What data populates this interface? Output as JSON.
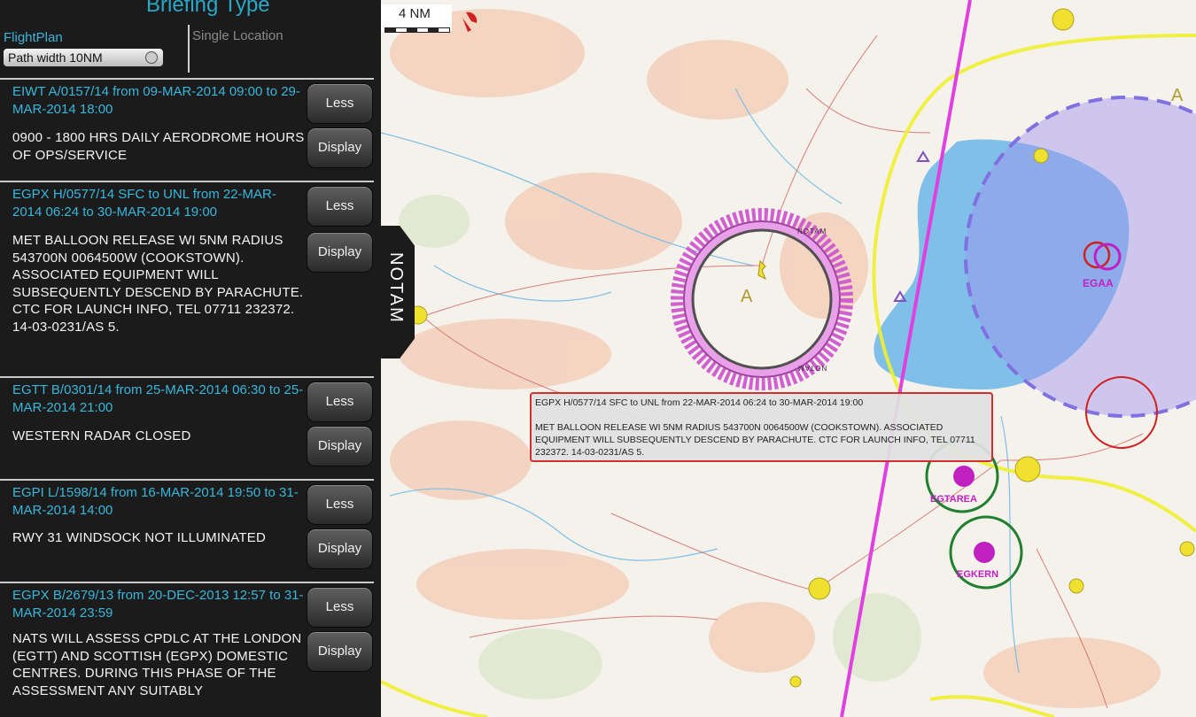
{
  "briefing": {
    "title": "Briefing Type",
    "tabs": {
      "flight_plan": "FlightPlan",
      "single_location": "Single Location"
    },
    "path_width": "Path width 10NM"
  },
  "notams": [
    {
      "id": "EIWT A/0157/14",
      "header": "EIWT A/0157/14 from 09-MAR-2014 09:00 to 29-MAR-2014 18:00",
      "text": "0900 - 1800 HRS DAILY AERODROME HOURS OF OPS/SERVICE",
      "less": "Less",
      "display": "Display",
      "active": false
    },
    {
      "id": "EGPX H/0577/14",
      "header": "EGPX H/0577/14 SFC to UNL from 22-MAR-2014 06:24 to 30-MAR-2014 19:00",
      "text": "MET BALLOON RELEASE WI 5NM RADIUS 543700N 0064500W (COOKSTOWN). ASSOCIATED EQUIPMENT WILL SUBSEQUENTLY DESCEND BY PARACHUTE. CTC FOR LAUNCH INFO, TEL 07711 232372. 14-03-0231/AS 5.",
      "less": "Less",
      "display": "Display",
      "active": true
    },
    {
      "id": "EGTT B/0301/14",
      "header": "EGTT B/0301/14 from 25-MAR-2014 06:30 to 25-MAR-2014 21:00",
      "text": "WESTERN RADAR CLOSED",
      "less": "Less",
      "display": "Display",
      "active": false
    },
    {
      "id": "EGPI L/1598/14",
      "header": "EGPI L/1598/14 from 16-MAR-2014 19:50 to 31-MAR-2014 14:00",
      "text": "RWY 31 WINDSOCK NOT ILLUMINATED",
      "less": "Less",
      "display": "Display",
      "active": false
    },
    {
      "id": "EGPX B/2679/13",
      "header": "EGPX B/2679/13 from 20-DEC-2013 12:57 to 31-MAR-2014 23:59",
      "text": "NATS WILL ASSESS CPDLC AT THE LONDON (EGTT) AND SCOTTISH (EGPX) DOMESTIC CENTRES. DURING THIS PHASE OF THE ASSESSMENT ANY SUITABLY",
      "less": "Less",
      "display": "Display",
      "active": false
    }
  ],
  "notam_tab_label": "NOTAM",
  "map": {
    "scale_label": "4 NM",
    "circle_label": "NOTAM",
    "airspace_class": "A",
    "aerodromes": [
      "EGAA",
      "EGTAREA",
      "EGKERN"
    ],
    "popup": {
      "header": "EGPX H/0577/14 SFC to UNL from 22-MAR-2014 06:24 to 30-MAR-2014 19:00",
      "text": "MET BALLOON RELEASE WI 5NM RADIUS 543700N 0064500W (COOKSTOWN). ASSOCIATED EQUIPMENT WILL SUBSEQUENTLY DESCEND BY PARACHUTE. CTC FOR LAUNCH INFO, TEL 07711 232372. 14-03-0231/AS 5."
    },
    "colors": {
      "route": "#e040e0",
      "airspace": "#f0f030",
      "notam_ring": "#c050c0",
      "lake": "#7fbfe8",
      "cta": "#a090f0"
    }
  }
}
